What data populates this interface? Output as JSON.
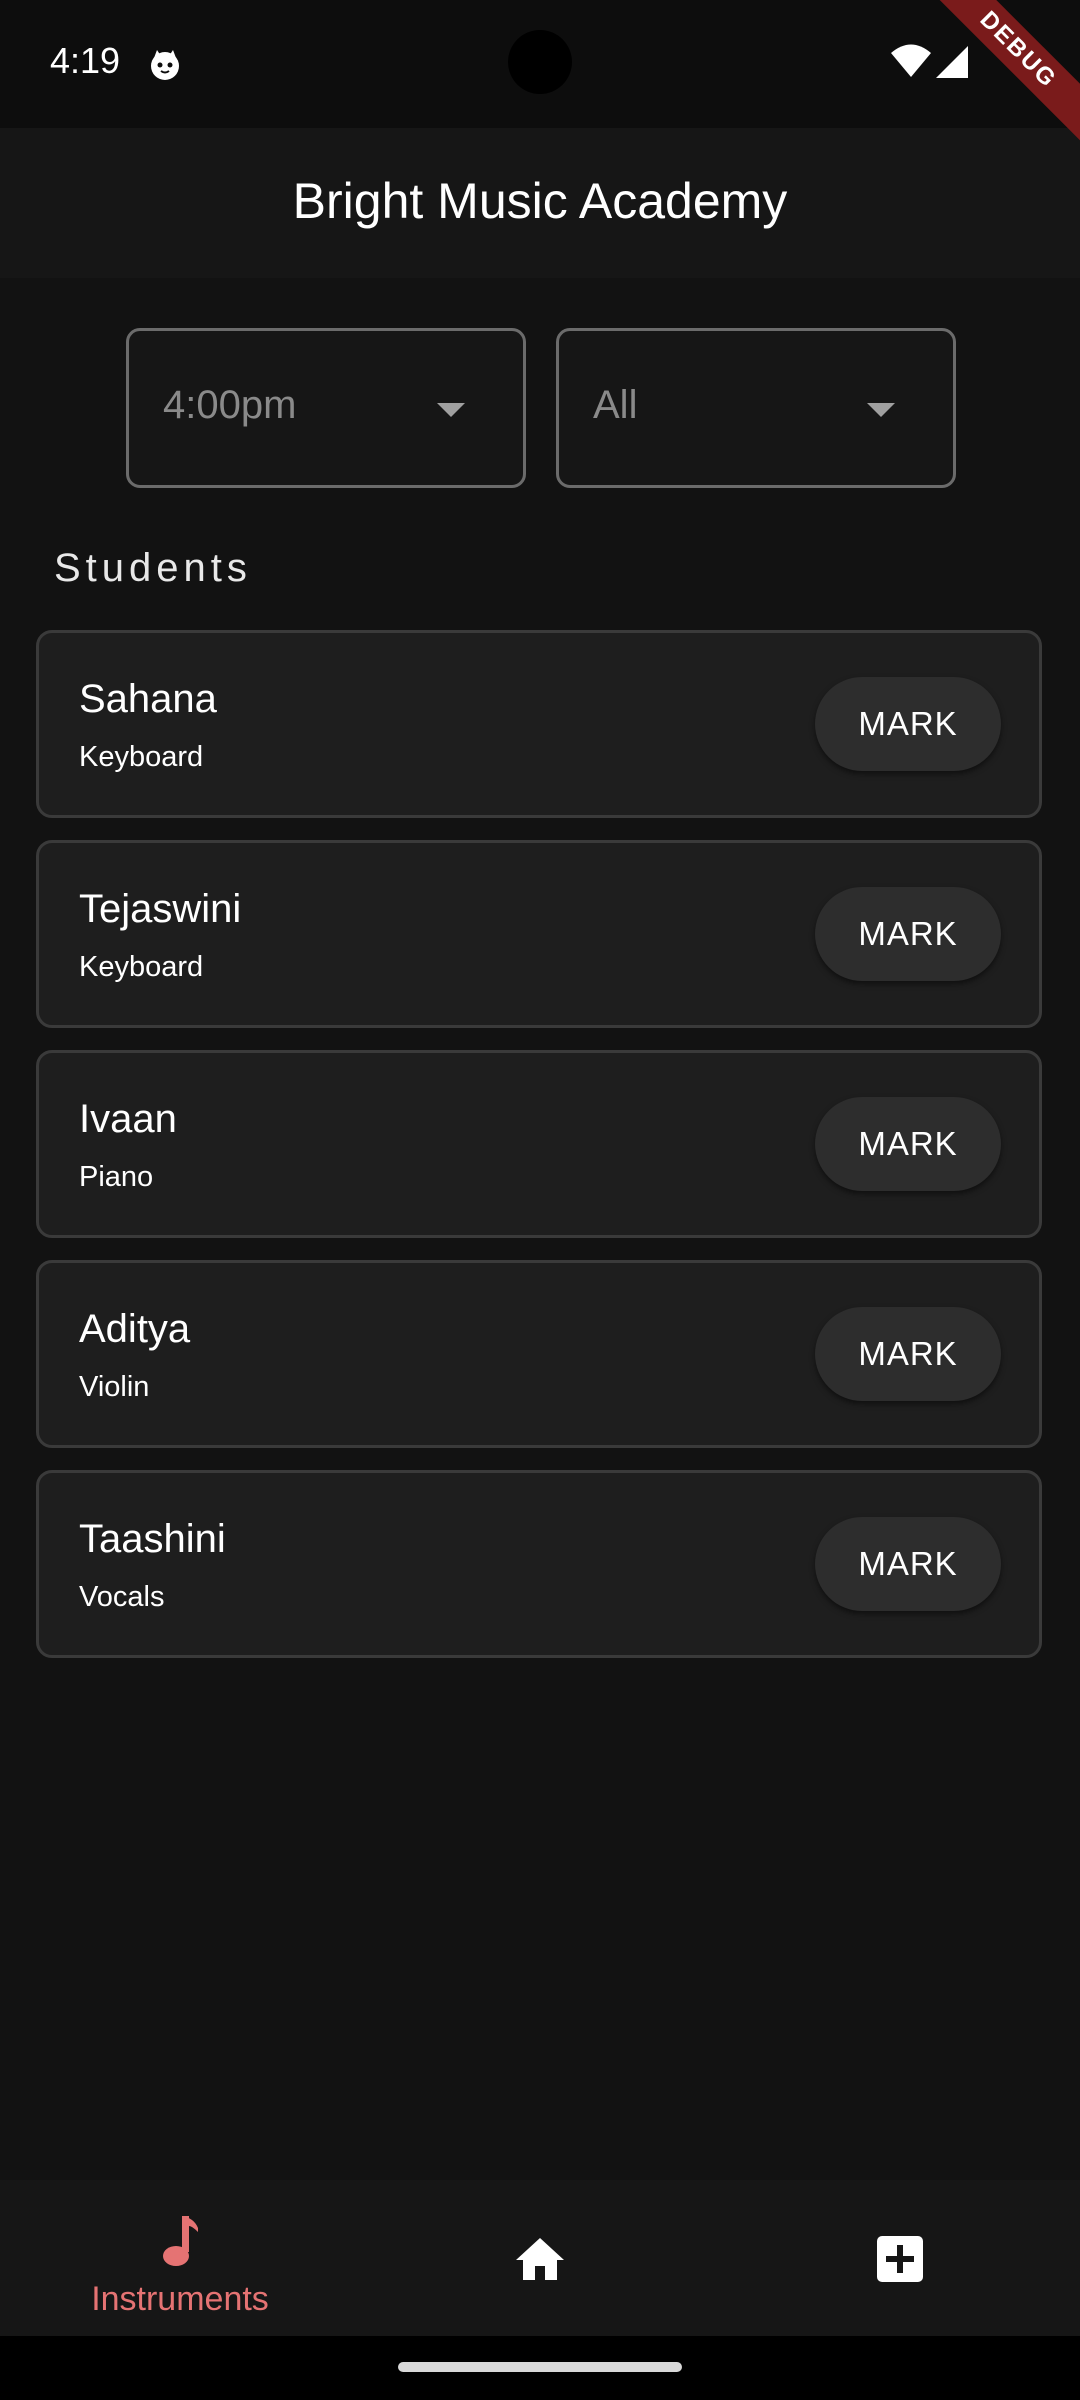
{
  "status_bar": {
    "time": "4:19",
    "debug_label": "DEBUG"
  },
  "app_bar": {
    "title": "Bright Music Academy"
  },
  "filters": {
    "time": {
      "selected": "4:00pm"
    },
    "instrument": {
      "selected": "All"
    }
  },
  "students": {
    "section_title": "Students",
    "items": [
      {
        "name": "Sahana",
        "instrument": "Keyboard",
        "action": "MARK"
      },
      {
        "name": "Tejaswini",
        "instrument": "Keyboard",
        "action": "MARK"
      },
      {
        "name": "Ivaan",
        "instrument": "Piano",
        "action": "MARK"
      },
      {
        "name": "Aditya",
        "instrument": "Violin",
        "action": "MARK"
      },
      {
        "name": "Taashini",
        "instrument": "Vocals",
        "action": "MARK"
      }
    ]
  },
  "bottom_nav": {
    "items": [
      {
        "label": "Instruments",
        "icon": "music-note-icon",
        "active": true
      },
      {
        "label": "",
        "icon": "home-icon",
        "active": false
      },
      {
        "label": "",
        "icon": "add-box-icon",
        "active": false
      }
    ]
  },
  "colors": {
    "background": "#121212",
    "card": "#1e1e1e",
    "accent": "#e57373",
    "button": "#2d2d2d"
  }
}
